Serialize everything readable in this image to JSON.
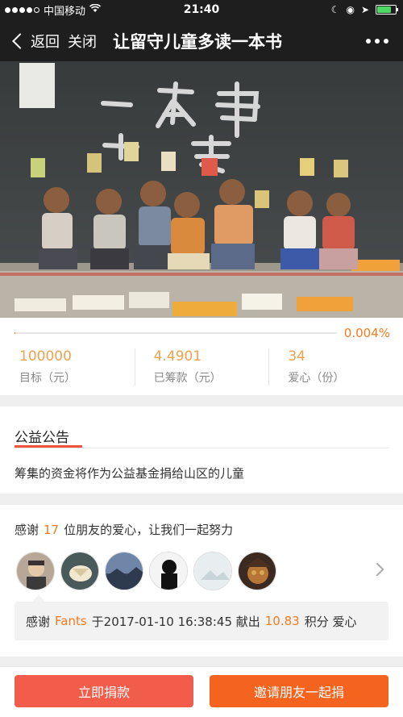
{
  "status_bar": {
    "carrier": "中国移动",
    "time": "21:40"
  },
  "nav": {
    "back_label": "返回",
    "close_label": "关闭",
    "title": "让留守儿童多读一本书"
  },
  "progress": {
    "percent_text": "0.004%",
    "fraction": 4e-05
  },
  "stats": [
    {
      "value": "100000",
      "label": "目标（元）"
    },
    {
      "value": "4.4901",
      "label": "已筹款（元）"
    },
    {
      "value": "34",
      "label": "爱心（份）"
    }
  ],
  "notice": {
    "title": "公益公告",
    "text": "筹集的资金将作为公益基金捐给山区的儿童"
  },
  "thanks": {
    "prefix": "感谢",
    "count": "17",
    "suffix": "位朋友的爱心，让我们一起努力",
    "donation": {
      "prefix": "感谢",
      "donor": "Fants",
      "time_text": "于2017-01-10 16:38:45 献出",
      "amount": "10.83",
      "suffix": "积分 爱心"
    }
  },
  "buttons": {
    "donate": "立即捐款",
    "invite": "邀请朋友一起捐"
  },
  "colors": {
    "accent": "#f47a20",
    "donate_button": "#f25d4b",
    "invite_button": "#f4641f",
    "nav_bg": "#1e1e1e"
  }
}
